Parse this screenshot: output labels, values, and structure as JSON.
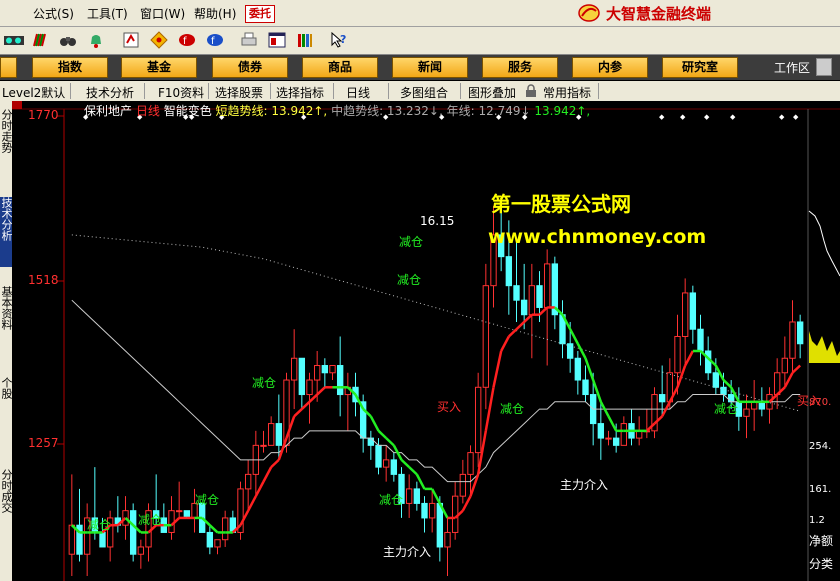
{
  "menu": {
    "items": [
      "公式(S)",
      "工具(T)",
      "窗口(W)",
      "帮助(H)"
    ],
    "wt_button": "委托",
    "brand": "大智慧金融终端"
  },
  "navbar": {
    "buttons": [
      "指数",
      "基金",
      "债券",
      "商品",
      "新闻",
      "服务",
      "内参",
      "研究室"
    ],
    "workspace": "工作区"
  },
  "subbar": {
    "items": [
      "Level2默认",
      "技术分析",
      "F10资料",
      "选择股票",
      "选择指标",
      "日线",
      "多图组合",
      "图形叠加",
      "常用指标"
    ]
  },
  "leftbar": {
    "tabs": [
      "分时走势",
      "技术分析",
      "基本资料",
      "个股",
      "分时成交"
    ]
  },
  "chart_header": {
    "stock_name": "保利地产",
    "period": "日线",
    "indicator": "智能变色",
    "short_label": "短趋势线: 13.942↑,",
    "mid_label": "中趋势线: 13.232↓,",
    "year_label": "年线: 12.749↓",
    "extra_label": "13.942↑,"
  },
  "price_axis": {
    "top": "1770",
    "mid": "1518",
    "low": "1257"
  },
  "right_labels": [
    "870.",
    "254.",
    "161.",
    "1.2",
    "净额",
    "分类"
  ],
  "watermark": {
    "title": "第一股票公式网",
    "url": "www.chnmoney.com"
  },
  "annotations": {
    "peak": "16.15",
    "reduce": "减仓",
    "buy": "买入",
    "main_force": "主力介入"
  },
  "colors": {
    "up": "#ff3232",
    "down": "#54ffff",
    "short_line_up": "#ff2020",
    "short_line_down": "#22ee22",
    "mid_line": "#cccccc",
    "year_line": "#bbbbbb",
    "axis": "#b00000",
    "watermark": "#ffff00"
  },
  "chart_data": {
    "type": "line",
    "ylim": [
      11,
      17.2
    ],
    "candles": [
      [
        11.0,
        11.3,
        12.4,
        11.7
      ],
      [
        11.2,
        11.7,
        12.2,
        11.3
      ],
      [
        11.0,
        11.3,
        12.0,
        11.8
      ],
      [
        11.5,
        11.8,
        12.5,
        11.6
      ],
      [
        11.4,
        11.6,
        11.8,
        11.4
      ],
      [
        11.2,
        11.4,
        11.9,
        11.8
      ],
      [
        11.6,
        11.8,
        12.1,
        11.7
      ],
      [
        11.5,
        11.7,
        12.1,
        11.9
      ],
      [
        11.2,
        11.9,
        12.0,
        11.3
      ],
      [
        11.1,
        11.3,
        11.5,
        11.4
      ],
      [
        11.2,
        11.4,
        12.0,
        11.9
      ],
      [
        11.7,
        11.9,
        12.4,
        11.8
      ],
      [
        11.6,
        11.8,
        12.0,
        11.6
      ],
      [
        11.5,
        11.6,
        12.1,
        11.9
      ],
      [
        11.8,
        11.9,
        12.3,
        11.9
      ],
      [
        11.8,
        11.9,
        11.9,
        11.8
      ],
      [
        11.6,
        11.8,
        12.2,
        12.0
      ],
      [
        11.6,
        12.0,
        12.0,
        11.6
      ],
      [
        11.3,
        11.6,
        11.7,
        11.4
      ],
      [
        11.3,
        11.4,
        11.5,
        11.5
      ],
      [
        11.4,
        11.5,
        11.9,
        11.8
      ],
      [
        11.6,
        11.8,
        11.9,
        11.6
      ],
      [
        11.5,
        11.6,
        12.3,
        12.2
      ],
      [
        11.9,
        12.2,
        12.6,
        12.4
      ],
      [
        12.1,
        12.4,
        13.0,
        12.8
      ],
      [
        12.7,
        12.8,
        13.0,
        12.8
      ],
      [
        12.8,
        12.8,
        13.2,
        13.1
      ],
      [
        12.6,
        13.1,
        13.5,
        12.8
      ],
      [
        12.7,
        12.8,
        13.8,
        13.7
      ],
      [
        13.3,
        13.7,
        14.4,
        14.0
      ],
      [
        13.3,
        14.0,
        14.0,
        13.5
      ],
      [
        13.1,
        13.5,
        13.8,
        13.7
      ],
      [
        13.4,
        13.7,
        14.1,
        13.9
      ],
      [
        13.6,
        13.9,
        14.0,
        13.8
      ],
      [
        13.7,
        13.8,
        13.9,
        13.9
      ],
      [
        13.2,
        13.9,
        14.3,
        13.5
      ],
      [
        13.0,
        13.5,
        13.8,
        13.6
      ],
      [
        13.2,
        13.6,
        13.8,
        13.4
      ],
      [
        12.7,
        13.4,
        13.5,
        12.9
      ],
      [
        12.6,
        12.9,
        13.0,
        12.8
      ],
      [
        12.4,
        12.8,
        12.9,
        12.5
      ],
      [
        12.3,
        12.5,
        12.8,
        12.6
      ],
      [
        12.3,
        12.6,
        12.7,
        12.4
      ],
      [
        11.8,
        12.4,
        12.5,
        12.0
      ],
      [
        11.8,
        12.0,
        12.4,
        12.2
      ],
      [
        11.9,
        12.2,
        12.3,
        12.0
      ],
      [
        11.6,
        12.0,
        12.1,
        11.8
      ],
      [
        11.6,
        11.8,
        12.2,
        12.0
      ],
      [
        11.2,
        12.0,
        12.1,
        11.4
      ],
      [
        11.0,
        11.4,
        11.8,
        11.6
      ],
      [
        11.5,
        11.6,
        12.3,
        12.1
      ],
      [
        12.0,
        12.1,
        12.6,
        12.4
      ],
      [
        12.1,
        12.4,
        12.8,
        12.7
      ],
      [
        12.5,
        12.7,
        13.8,
        13.6
      ],
      [
        13.3,
        13.6,
        15.3,
        15.0
      ],
      [
        14.7,
        15.0,
        16.1,
        15.7
      ],
      [
        15.2,
        15.7,
        16.15,
        15.4
      ],
      [
        14.6,
        15.4,
        15.9,
        15.0
      ],
      [
        14.5,
        15.0,
        15.6,
        14.8
      ],
      [
        14.4,
        14.8,
        15.3,
        14.6
      ],
      [
        14.0,
        14.6,
        15.3,
        15.0
      ],
      [
        14.5,
        15.0,
        15.2,
        14.7
      ],
      [
        13.9,
        14.7,
        15.5,
        15.3
      ],
      [
        14.4,
        15.3,
        15.4,
        14.6
      ],
      [
        14.0,
        14.6,
        14.8,
        14.2
      ],
      [
        13.8,
        14.2,
        14.5,
        14.0
      ],
      [
        13.5,
        14.0,
        14.1,
        13.7
      ],
      [
        13.4,
        13.7,
        13.9,
        13.5
      ],
      [
        12.8,
        13.5,
        13.8,
        13.1
      ],
      [
        12.6,
        13.1,
        13.4,
        12.9
      ],
      [
        12.8,
        12.9,
        13.0,
        12.9
      ],
      [
        12.7,
        12.9,
        13.1,
        12.8
      ],
      [
        12.8,
        12.8,
        13.2,
        13.1
      ],
      [
        12.8,
        13.1,
        13.3,
        12.9
      ],
      [
        12.8,
        12.9,
        13.2,
        13.0
      ],
      [
        12.9,
        13.0,
        13.3,
        13.0
      ],
      [
        12.9,
        13.0,
        13.6,
        13.5
      ],
      [
        13.2,
        13.5,
        13.9,
        13.4
      ],
      [
        13.3,
        13.4,
        14.0,
        13.8
      ],
      [
        13.5,
        13.8,
        14.6,
        14.3
      ],
      [
        13.9,
        14.3,
        15.1,
        14.9
      ],
      [
        14.2,
        14.9,
        15.0,
        14.4
      ],
      [
        13.9,
        14.4,
        14.6,
        14.1
      ],
      [
        13.7,
        14.1,
        14.3,
        13.8
      ],
      [
        13.5,
        13.8,
        14.0,
        13.6
      ],
      [
        13.4,
        13.6,
        13.8,
        13.5
      ],
      [
        13.3,
        13.5,
        13.7,
        13.4
      ],
      [
        13.0,
        13.4,
        13.6,
        13.2
      ],
      [
        12.9,
        13.2,
        13.5,
        13.3
      ],
      [
        13.0,
        13.3,
        13.7,
        13.4
      ],
      [
        13.2,
        13.4,
        13.6,
        13.3
      ],
      [
        13.1,
        13.3,
        13.6,
        13.5
      ],
      [
        13.3,
        13.5,
        14.0,
        13.8
      ],
      [
        13.6,
        13.8,
        14.3,
        14.0
      ],
      [
        13.8,
        14.0,
        14.8,
        14.5
      ],
      [
        14.0,
        14.5,
        14.6,
        14.2
      ]
    ],
    "short_line": [
      11.7,
      11.6,
      11.6,
      11.6,
      11.6,
      11.7,
      11.7,
      11.8,
      11.7,
      11.6,
      11.6,
      11.7,
      11.7,
      11.7,
      11.8,
      11.8,
      11.8,
      11.8,
      11.7,
      11.6,
      11.6,
      11.6,
      11.7,
      11.9,
      12.1,
      12.3,
      12.5,
      12.6,
      12.9,
      13.2,
      13.3,
      13.4,
      13.5,
      13.6,
      13.6,
      13.6,
      13.6,
      13.5,
      13.3,
      13.2,
      13.0,
      12.9,
      12.8,
      12.6,
      12.5,
      12.4,
      12.2,
      12.2,
      12.0,
      11.8,
      11.8,
      11.9,
      12.1,
      12.4,
      13.0,
      13.6,
      14.1,
      14.3,
      14.4,
      14.5,
      14.6,
      14.6,
      14.7,
      14.7,
      14.6,
      14.4,
      14.2,
      14.0,
      13.7,
      13.4,
      13.2,
      13.0,
      13.0,
      13.0,
      13.0,
      13.0,
      13.1,
      13.2,
      13.4,
      13.6,
      13.9,
      14.1,
      14.1,
      14.0,
      13.9,
      13.7,
      13.6,
      13.4,
      13.4,
      13.4,
      13.4,
      13.4,
      13.5,
      13.6,
      13.8,
      13.9
    ],
    "short_line_up": [
      true,
      false,
      false,
      false,
      false,
      true,
      true,
      true,
      false,
      false,
      false,
      true,
      true,
      false,
      true,
      true,
      true,
      false,
      false,
      false,
      false,
      false,
      true,
      true,
      true,
      true,
      true,
      true,
      true,
      true,
      true,
      true,
      true,
      true,
      true,
      false,
      false,
      false,
      false,
      false,
      false,
      false,
      false,
      false,
      false,
      false,
      false,
      false,
      false,
      false,
      true,
      true,
      true,
      true,
      true,
      true,
      true,
      true,
      true,
      true,
      true,
      true,
      true,
      true,
      false,
      false,
      false,
      false,
      false,
      false,
      false,
      false,
      false,
      false,
      false,
      false,
      true,
      true,
      true,
      true,
      true,
      true,
      false,
      false,
      false,
      false,
      false,
      false,
      false,
      false,
      false,
      false,
      true,
      true,
      true,
      true
    ],
    "mid_line": [
      14.8,
      14.7,
      14.6,
      14.5,
      14.4,
      14.3,
      14.2,
      14.1,
      14.0,
      13.9,
      13.8,
      13.7,
      13.6,
      13.5,
      13.4,
      13.3,
      13.2,
      13.1,
      13.0,
      12.9,
      12.8,
      12.7,
      12.6,
      12.6,
      12.6,
      12.6,
      12.7,
      12.7,
      12.8,
      12.9,
      12.9,
      13.0,
      13.0,
      13.0,
      13.0,
      13.0,
      13.0,
      13.0,
      12.9,
      12.9,
      12.8,
      12.8,
      12.7,
      12.7,
      12.6,
      12.6,
      12.5,
      12.5,
      12.4,
      12.3,
      12.3,
      12.3,
      12.3,
      12.4,
      12.5,
      12.7,
      12.8,
      12.9,
      13.0,
      13.1,
      13.2,
      13.3,
      13.3,
      13.4,
      13.4,
      13.4,
      13.4,
      13.4,
      13.3,
      13.3,
      13.3,
      13.3,
      13.3,
      13.3,
      13.3,
      13.3,
      13.3,
      13.3,
      13.3,
      13.4,
      13.4,
      13.5,
      13.5,
      13.5,
      13.5,
      13.5,
      13.4,
      13.4,
      13.4,
      13.4,
      13.4,
      13.4,
      13.4,
      13.4,
      13.5,
      13.5
    ],
    "year_line": [
      15.7,
      15.69,
      15.68,
      15.67,
      15.66,
      15.65,
      15.64,
      15.63,
      15.62,
      15.61,
      15.6,
      15.59,
      15.58,
      15.57,
      15.56,
      15.55,
      15.54,
      15.53,
      15.51,
      15.49,
      15.47,
      15.45,
      15.43,
      15.41,
      15.39,
      15.37,
      15.34,
      15.31,
      15.28,
      15.25,
      15.22,
      15.19,
      15.16,
      15.13,
      15.1,
      15.07,
      15.04,
      15.01,
      14.98,
      14.95,
      14.92,
      14.89,
      14.86,
      14.83,
      14.8,
      14.77,
      14.74,
      14.71,
      14.68,
      14.65,
      14.62,
      14.59,
      14.56,
      14.53,
      14.5,
      14.47,
      14.44,
      14.41,
      14.38,
      14.35,
      14.32,
      14.29,
      14.26,
      14.23,
      14.2,
      14.17,
      14.14,
      14.11,
      14.08,
      14.05,
      14.02,
      13.99,
      13.96,
      13.93,
      13.9,
      13.87,
      13.84,
      13.81,
      13.78,
      13.75,
      13.72,
      13.69,
      13.66,
      13.63,
      13.6,
      13.57,
      13.54,
      13.51,
      13.48,
      13.45,
      13.42,
      13.39,
      13.36,
      13.33,
      13.3,
      13.27
    ]
  }
}
